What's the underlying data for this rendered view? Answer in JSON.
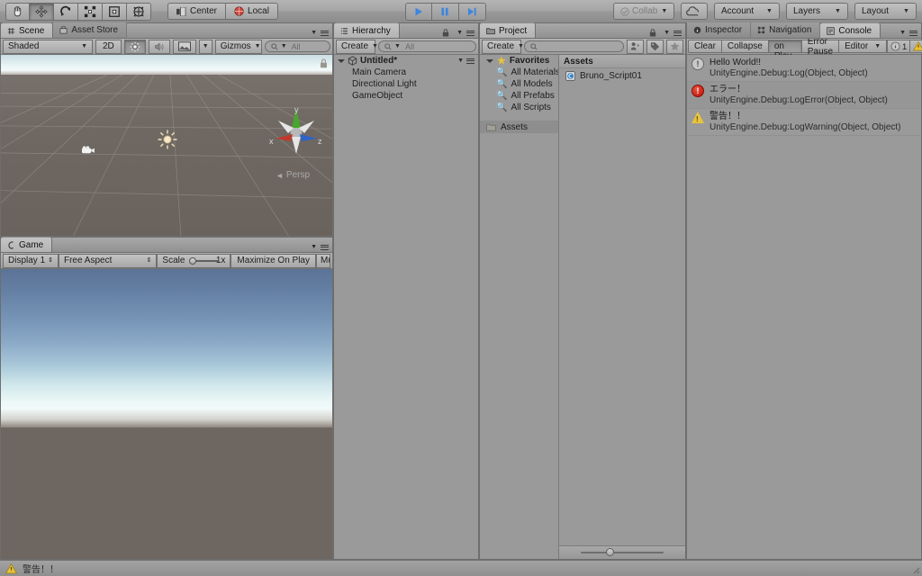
{
  "toolbar": {
    "tools": [
      {
        "name": "hand-tool",
        "icon": "hand",
        "active": false
      },
      {
        "name": "move-tool",
        "icon": "move",
        "active": true
      },
      {
        "name": "rotate-tool",
        "icon": "rotate",
        "active": false
      },
      {
        "name": "scale-tool",
        "icon": "scale",
        "active": false
      },
      {
        "name": "rect-tool",
        "icon": "rect",
        "active": false
      },
      {
        "name": "transform-tool",
        "icon": "transform",
        "active": false
      }
    ],
    "pivot_label": "Center",
    "space_label": "Local",
    "play_label": "play",
    "pause_label": "pause",
    "step_label": "step",
    "collab_label": "Collab",
    "cloud_label": "cloud",
    "account_label": "Account",
    "layers_label": "Layers",
    "layout_label": "Layout"
  },
  "scene_panel": {
    "tabs": [
      {
        "label": "Scene",
        "active": true
      },
      {
        "label": "Asset Store",
        "active": false
      }
    ],
    "shading_mode": "Shaded",
    "toggle_2d": "2D",
    "lighting_icon": "sun-icon",
    "audio_icon": "speaker-icon",
    "effects_icon": "image-icon",
    "gizmos_label": "Gizmos",
    "search_placeholder": "All",
    "axis_x": "x",
    "axis_y": "y",
    "axis_z": "z",
    "projection_label": "Persp"
  },
  "game_panel": {
    "tab_label": "Game",
    "display": "Display 1",
    "aspect": "Free Aspect",
    "scale_label": "Scale",
    "scale_value": "1x",
    "maximize_label": "Maximize On Play",
    "mute_label": "Mu"
  },
  "hierarchy": {
    "tab_label": "Hierarchy",
    "create_label": "Create",
    "search_placeholder": "All",
    "scene_name": "Untitled*",
    "objects": [
      {
        "label": "Main Camera"
      },
      {
        "label": "Directional Light"
      },
      {
        "label": "GameObject"
      }
    ]
  },
  "project": {
    "tab_label": "Project",
    "create_label": "Create",
    "search_placeholder": "",
    "favorites_label": "Favorites",
    "favorites": [
      {
        "label": "All Materials"
      },
      {
        "label": "All Models"
      },
      {
        "label": "All Prefabs"
      },
      {
        "label": "All Scripts"
      }
    ],
    "folders": [
      {
        "label": "Assets",
        "selected": true
      }
    ],
    "assets_header": "Assets",
    "assets": [
      {
        "label": "Bruno_Script01",
        "icon": "csharp-script-icon"
      }
    ]
  },
  "console": {
    "tabs": [
      {
        "label": "Inspector",
        "active": false,
        "icon": "info-icon"
      },
      {
        "label": "Navigation",
        "active": false,
        "icon": "nav-icon"
      },
      {
        "label": "Console",
        "active": true,
        "icon": "console-icon"
      }
    ],
    "clear_label": "Clear",
    "collapse_label": "Collapse",
    "clear_on_play_label": "Clear on Play",
    "error_pause_label": "Error Pause",
    "editor_label": "Editor",
    "info_count": "1",
    "warn_count": "",
    "entries": [
      {
        "type": "info",
        "message": "Hello World!!",
        "stack": "UnityEngine.Debug:Log(Object, Object)"
      },
      {
        "type": "error",
        "message": "エラー！",
        "stack": "UnityEngine.Debug:LogError(Object, Object)"
      },
      {
        "type": "warning",
        "message": "警告！！",
        "stack": "UnityEngine.Debug:LogWarning(Object, Object)"
      }
    ]
  },
  "statusbar": {
    "icon": "warning-icon",
    "message": "警告！！"
  },
  "colors": {
    "chrome": "#9a9a9a",
    "accent_play": "#3d86e0",
    "error": "#bc1208",
    "warning": "#e8c33c",
    "axis_x": "#c0392b",
    "axis_y": "#4aa52e",
    "axis_z": "#2f63c9"
  }
}
